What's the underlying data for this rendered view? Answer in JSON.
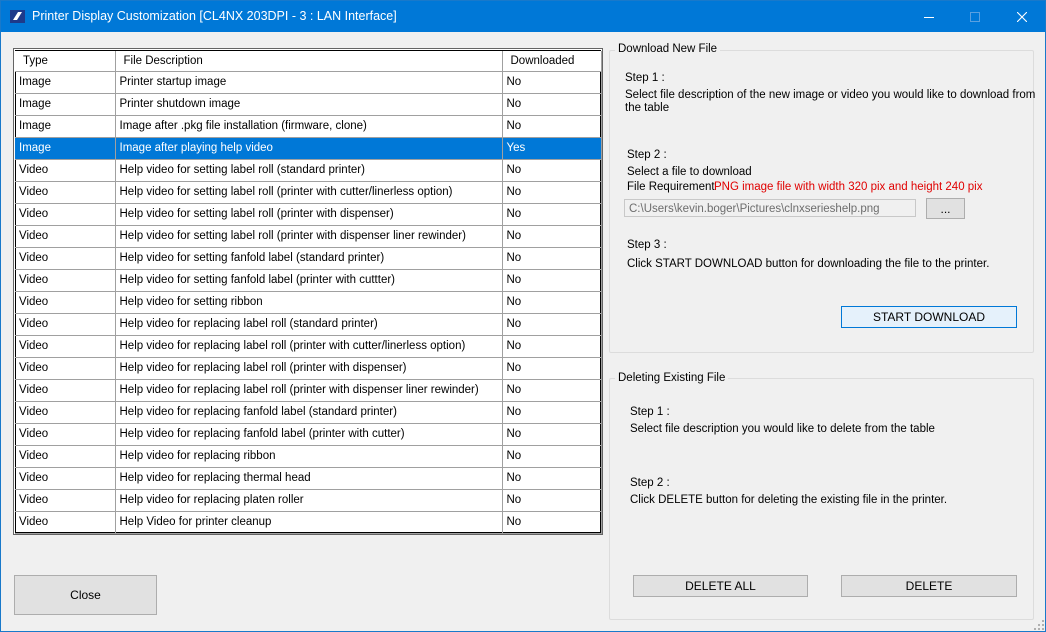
{
  "window": {
    "title": "Printer Display Customization [CL4NX 203DPI - 3 : LAN Interface]"
  },
  "table": {
    "headers": {
      "type": "Type",
      "description": "File Description",
      "downloaded": "Downloaded"
    },
    "rows": [
      {
        "type": "Image",
        "description": "Printer startup image",
        "downloaded": "No"
      },
      {
        "type": "Image",
        "description": "Printer shutdown image",
        "downloaded": "No"
      },
      {
        "type": "Image",
        "description": "Image after .pkg file installation (firmware, clone)",
        "downloaded": "No"
      },
      {
        "type": "Image",
        "description": "Image after playing help video",
        "downloaded": "Yes"
      },
      {
        "type": "Video",
        "description": "Help video for setting label roll (standard printer)",
        "downloaded": "No"
      },
      {
        "type": "Video",
        "description": "Help video for setting label roll (printer with cutter/linerless option)",
        "downloaded": "No"
      },
      {
        "type": "Video",
        "description": "Help video for setting label roll (printer with dispenser)",
        "downloaded": "No"
      },
      {
        "type": "Video",
        "description": "Help video for setting label roll (printer with dispenser liner rewinder)",
        "downloaded": "No"
      },
      {
        "type": "Video",
        "description": "Help video for setting fanfold label (standard printer)",
        "downloaded": "No"
      },
      {
        "type": "Video",
        "description": "Help video for setting fanfold label (printer with cuttter)",
        "downloaded": "No"
      },
      {
        "type": "Video",
        "description": "Help video for setting ribbon",
        "downloaded": "No"
      },
      {
        "type": "Video",
        "description": "Help video for replacing label roll (standard printer)",
        "downloaded": "No"
      },
      {
        "type": "Video",
        "description": "Help video for replacing label roll (printer with cutter/linerless option)",
        "downloaded": "No"
      },
      {
        "type": "Video",
        "description": "Help video for replacing label roll (printer with dispenser)",
        "downloaded": "No"
      },
      {
        "type": "Video",
        "description": "Help video for replacing label roll (printer with dispenser liner rewinder)",
        "downloaded": "No"
      },
      {
        "type": "Video",
        "description": "Help video for replacing fanfold label (standard printer)",
        "downloaded": "No"
      },
      {
        "type": "Video",
        "description": "Help video for replacing fanfold label (printer with cutter)",
        "downloaded": "No"
      },
      {
        "type": "Video",
        "description": "Help video for replacing ribbon",
        "downloaded": "No"
      },
      {
        "type": "Video",
        "description": "Help video for replacing thermal head",
        "downloaded": "No"
      },
      {
        "type": "Video",
        "description": "Help video for replacing platen roller",
        "downloaded": "No"
      },
      {
        "type": "Video",
        "description": "Help Video for printer cleanup",
        "downloaded": "No"
      }
    ],
    "selected_index": 3
  },
  "download": {
    "group_label": "Download New File",
    "step1_title": "Step 1 :",
    "step1_text_line1": "Select file description of the new image or video you would like to download from",
    "step1_text_line2": "the table",
    "step2_title": "Step 2 :",
    "step2_text": "Select a file to download",
    "requirement_label": "File Requirement",
    "requirement_value": "PNG image file with width 320 pix and height 240 pix",
    "file_path": "C:\\Users\\kevin.boger\\Pictures\\clnxserieshelp.png",
    "browse_label": "...",
    "step3_title": "Step 3 :",
    "step3_text": "Click START DOWNLOAD button for downloading the file to the printer.",
    "start_button": "START DOWNLOAD"
  },
  "delete": {
    "group_label": "Deleting Existing File",
    "step1_title": "Step 1 :",
    "step1_text": "Select file description you would like to delete from the table",
    "step2_title": "Step 2 :",
    "step2_text": "Click DELETE button for deleting the existing file in the printer.",
    "delete_all_button": "DELETE ALL",
    "delete_button": "DELETE"
  },
  "footer": {
    "close_button": "Close"
  },
  "colors": {
    "titlebar": "#0078d7",
    "selection": "#0078d7",
    "requirement": "#e00000"
  }
}
